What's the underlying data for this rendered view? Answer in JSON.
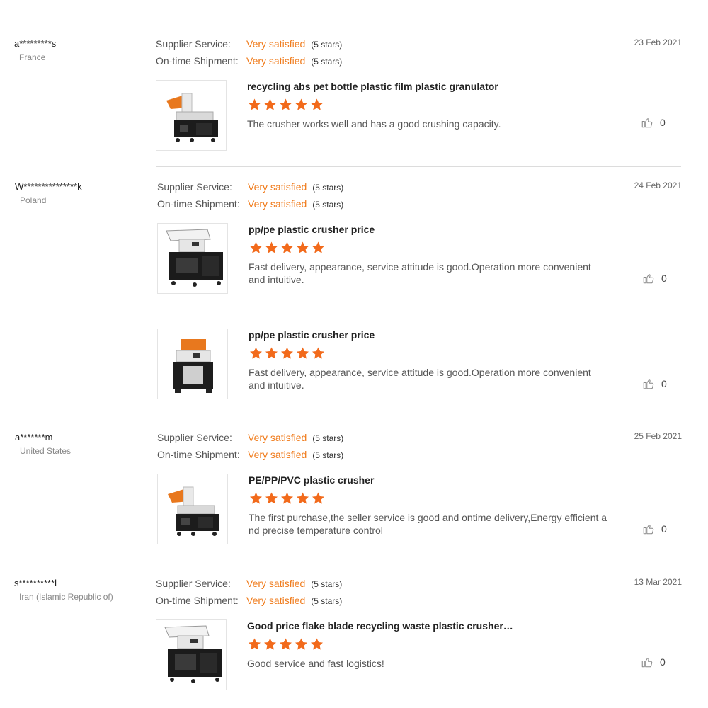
{
  "labels": {
    "supplier_service": "Supplier Service:",
    "ontime_shipment": "On-time Shipment:"
  },
  "colors": {
    "accent": "#f07c1d",
    "star": "#f26a1b",
    "divider": "#dcdcdc"
  },
  "reviews": [
    {
      "reviewer": "a*********s",
      "country": "France",
      "date": "23 Feb 2021",
      "supplier_rating": "Very satisfied",
      "supplier_stars": "(5 stars)",
      "shipment_rating": "Very satisfied",
      "shipment_stars": "(5 stars)",
      "products": [
        {
          "title": "recycling abs pet bottle plastic film plastic granulator",
          "stars": 5,
          "comment": "The crusher works well and has a good crushing capacity.",
          "likes": "0",
          "image": "crusher-orange-hopper"
        }
      ]
    },
    {
      "reviewer": "W***************k",
      "country": "Poland",
      "date": "24 Feb 2021",
      "supplier_rating": "Very satisfied",
      "supplier_stars": "(5 stars)",
      "shipment_rating": "Very satisfied",
      "shipment_stars": "(5 stars)",
      "products": [
        {
          "title": "pp/pe plastic crusher price",
          "stars": 5,
          "comment": "Fast delivery, appearance, service attitude is good.Operation more convenient and intuitive.",
          "likes": "0",
          "image": "crusher-white-hopper"
        },
        {
          "title": "pp/pe plastic crusher price",
          "stars": 5,
          "comment": "Fast delivery, appearance, service attitude is good.Operation more convenient and intuitive.",
          "likes": "0",
          "image": "crusher-orange-top"
        }
      ]
    },
    {
      "reviewer": "a*******m",
      "country": "United States",
      "date": "25 Feb 2021",
      "supplier_rating": "Very satisfied",
      "supplier_stars": "(5 stars)",
      "shipment_rating": "Very satisfied",
      "shipment_stars": "(5 stars)",
      "products": [
        {
          "title": "PE/PP/PVC plastic crusher",
          "stars": 5,
          "comment": "The first purchase,the seller service is good and ontime delivery,Energy efficient a nd precise temperature control",
          "likes": "0",
          "image": "crusher-orange-hopper"
        }
      ]
    },
    {
      "reviewer": "s**********l",
      "country": "Iran (Islamic Republic of)",
      "date": "13 Mar 2021",
      "supplier_rating": "Very satisfied",
      "supplier_stars": "(5 stars)",
      "shipment_rating": "Very satisfied",
      "shipment_stars": "(5 stars)",
      "products": [
        {
          "title": "Good price flake blade recycling waste plastic crusher…",
          "stars": 5,
          "comment": "Good service and fast logistics!",
          "likes": "0",
          "image": "crusher-white-hopper"
        }
      ]
    }
  ]
}
